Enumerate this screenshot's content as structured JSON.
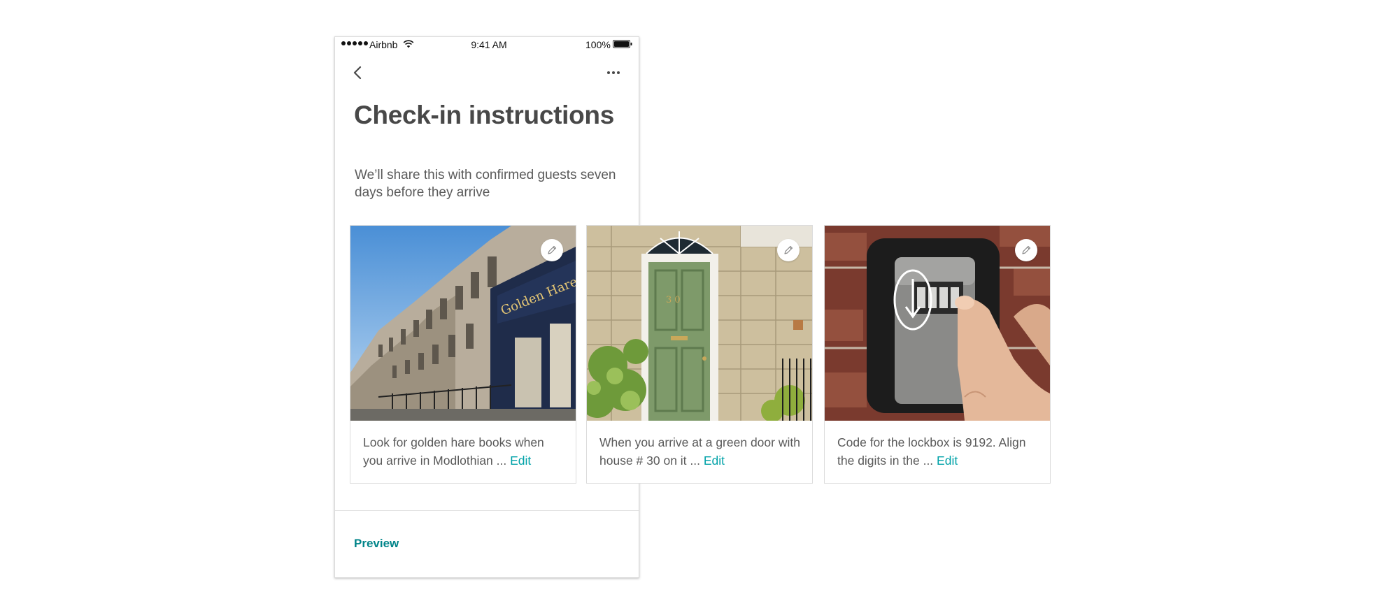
{
  "status_bar": {
    "carrier": "Airbnb",
    "time": "9:41 AM",
    "battery": "100%"
  },
  "header": {
    "back_icon": "chevron-left-icon",
    "more_icon": "ellipsis-icon"
  },
  "page": {
    "title": "Check-in instructions",
    "subtitle": "We’ll share this with confirmed guests seven days before they arrive"
  },
  "cards": [
    {
      "text": "Look for golden hare books when you arrive in Modlothian ...",
      "edit_label": "Edit",
      "edit_icon": "pencil-icon"
    },
    {
      "text": "When you arrive at a green door with house # 30 on it ...",
      "edit_label": "Edit",
      "edit_icon": "pencil-icon"
    },
    {
      "text": "Code for the lockbox is 9192. Align the digits in the ...",
      "edit_label": "Edit",
      "edit_icon": "pencil-icon"
    }
  ],
  "footer": {
    "preview_label": "Preview"
  },
  "colors": {
    "accent": "#008489",
    "link": "#00a2a8",
    "text": "#484848"
  }
}
